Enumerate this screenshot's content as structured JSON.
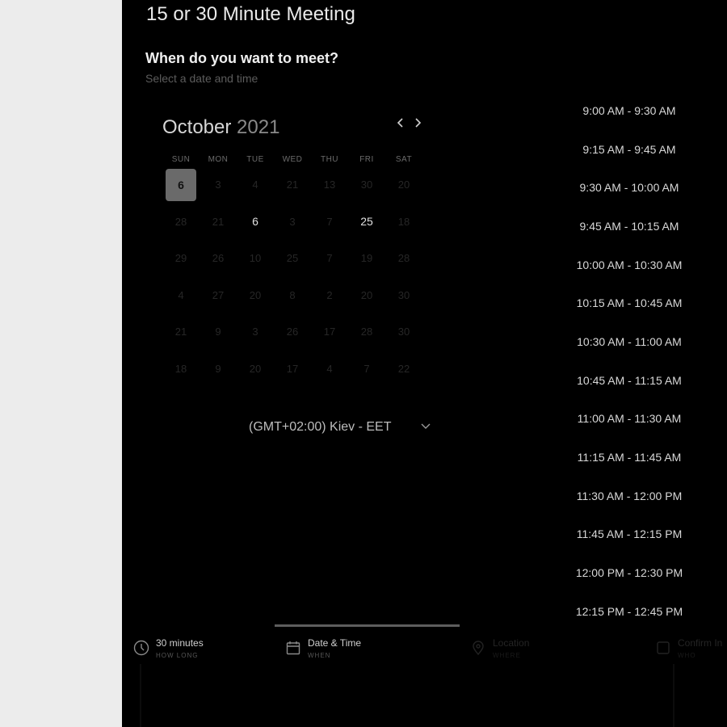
{
  "meeting": {
    "title": "15 or 30 Minute Meeting",
    "step_heading": "When do you want to meet?",
    "step_sub": "Select a date and time"
  },
  "calendar": {
    "month": "October",
    "year": "2021",
    "prev_icon": "chevron-left-icon",
    "next_icon": "chevron-right-icon",
    "weekdays": [
      "SUN",
      "MON",
      "TUE",
      "WED",
      "THU",
      "FRI",
      "SAT"
    ],
    "weeks": [
      [
        {
          "d": "6",
          "s": "selected"
        },
        {
          "d": "3",
          "s": "unavailable"
        },
        {
          "d": "4",
          "s": "unavailable"
        },
        {
          "d": "21",
          "s": "unavailable"
        },
        {
          "d": "13",
          "s": "unavailable"
        },
        {
          "d": "30",
          "s": "unavailable"
        },
        {
          "d": "20",
          "s": "unavailable"
        }
      ],
      [
        {
          "d": "28",
          "s": "unavailable"
        },
        {
          "d": "21",
          "s": "unavailable"
        },
        {
          "d": "6",
          "s": "available"
        },
        {
          "d": "3",
          "s": "unavailable"
        },
        {
          "d": "7",
          "s": "unavailable"
        },
        {
          "d": "25",
          "s": "available"
        },
        {
          "d": "18",
          "s": "unavailable"
        }
      ],
      [
        {
          "d": "29",
          "s": "unavailable"
        },
        {
          "d": "26",
          "s": "unavailable"
        },
        {
          "d": "10",
          "s": "unavailable"
        },
        {
          "d": "25",
          "s": "unavailable"
        },
        {
          "d": "7",
          "s": "unavailable"
        },
        {
          "d": "19",
          "s": "unavailable"
        },
        {
          "d": "28",
          "s": "unavailable"
        }
      ],
      [
        {
          "d": "4",
          "s": "unavailable"
        },
        {
          "d": "27",
          "s": "unavailable"
        },
        {
          "d": "20",
          "s": "unavailable"
        },
        {
          "d": "8",
          "s": "unavailable"
        },
        {
          "d": "2",
          "s": "unavailable"
        },
        {
          "d": "20",
          "s": "unavailable"
        },
        {
          "d": "30",
          "s": "unavailable"
        }
      ],
      [
        {
          "d": "21",
          "s": "unavailable"
        },
        {
          "d": "9",
          "s": "unavailable"
        },
        {
          "d": "3",
          "s": "unavailable"
        },
        {
          "d": "26",
          "s": "unavailable"
        },
        {
          "d": "17",
          "s": "unavailable"
        },
        {
          "d": "28",
          "s": "unavailable"
        },
        {
          "d": "30",
          "s": "unavailable"
        }
      ],
      [
        {
          "d": "18",
          "s": "unavailable"
        },
        {
          "d": "9",
          "s": "unavailable"
        },
        {
          "d": "20",
          "s": "unavailable"
        },
        {
          "d": "17",
          "s": "unavailable"
        },
        {
          "d": "4",
          "s": "unavailable"
        },
        {
          "d": "7",
          "s": "unavailable"
        },
        {
          "d": "22",
          "s": "unavailable"
        }
      ]
    ]
  },
  "timezone": {
    "label": "(GMT+02:00) Kiev - EET",
    "chevron_icon": "chevron-down-icon"
  },
  "time_slots": [
    "9:00 AM - 9:30 AM",
    "9:15 AM - 9:45 AM",
    "9:30 AM - 10:00 AM",
    "9:45 AM - 10:15 AM",
    "10:00 AM - 10:30 AM",
    "10:15 AM - 10:45 AM",
    "10:30 AM - 11:00 AM",
    "10:45 AM - 11:15 AM",
    "11:00 AM - 11:30 AM",
    "11:15 AM - 11:45 AM",
    "11:30 AM - 12:00 PM",
    "11:45 AM - 12:15 PM",
    "12:00 PM - 12:30 PM",
    "12:15 PM - 12:45 PM"
  ],
  "progress": {
    "active_step": 2,
    "steps": [
      {
        "title": "30 minutes",
        "subtitle": "HOW LONG",
        "icon": "clock-icon"
      },
      {
        "title": "Date & Time",
        "subtitle": "WHEN",
        "icon": "calendar-icon"
      },
      {
        "title": "Location",
        "subtitle": "WHERE",
        "icon": "location-pin-icon"
      },
      {
        "title": "Confirm In",
        "subtitle": "WHO",
        "icon": "confirm-icon"
      }
    ]
  },
  "colors": {
    "panel_bg": "#000000",
    "page_bg": "#ececec",
    "selected_day_bg": "#6a6a6a",
    "active_step_bar": "#5d5d5d"
  }
}
